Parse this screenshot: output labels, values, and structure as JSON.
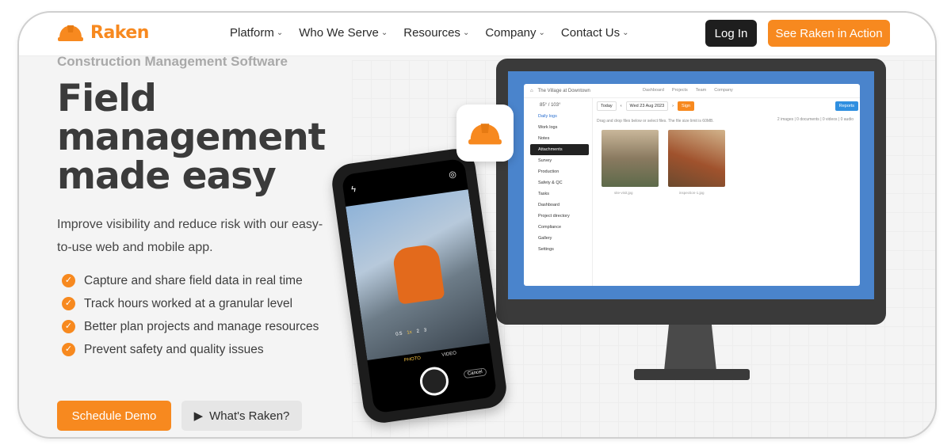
{
  "nav": {
    "brand": "Raken",
    "menu": [
      {
        "label": "Platform"
      },
      {
        "label": "Who We Serve"
      },
      {
        "label": "Resources"
      },
      {
        "label": "Company"
      },
      {
        "label": "Contact Us"
      }
    ],
    "login_label": "Log In",
    "cta_label": "See Raken in Action"
  },
  "hero": {
    "eyebrow": "Construction Management Software",
    "headline_1": "Field",
    "headline_2": "management",
    "headline_3": "made easy",
    "lead": "Improve visibility and reduce risk with our easy-to-use web and mobile app.",
    "bullets": [
      "Capture and share field data in real time",
      "Track hours worked at a granular level",
      "Better plan projects and manage resources",
      "Prevent safety and quality issues"
    ],
    "demo_label": "Schedule Demo",
    "what_label": "What's Raken?"
  },
  "monitor_app": {
    "project": "The Village at Downtown",
    "links": [
      "Dashboard",
      "Projects",
      "Team",
      "Company"
    ],
    "weather": "85° / 103°",
    "today": "Today",
    "date": "Wed 23 Aug 2023",
    "sign": "Sign",
    "reports": "Reports",
    "upload_hint": "Drag and drop files below or select files. The file size limit is 60MB.",
    "counts": "2 images | 0 documents | 0 videos | 0 audio",
    "side_items": [
      "Daily logs",
      "Work logs",
      "Notes",
      "Attachments",
      "Survey",
      "Production",
      "Safety & QC",
      "Tasks",
      "Dashboard",
      "Project directory",
      "Compliance",
      "Gallery",
      "Settings"
    ],
    "files": [
      "site-visit.jpg",
      "inspection-1.jpg"
    ]
  },
  "phone": {
    "mode_photo": "PHOTO",
    "mode_video": "VIDEO",
    "cancel": "Cancel",
    "zoom": [
      "0.5",
      "1x",
      "2",
      "3"
    ]
  },
  "colors": {
    "accent": "#f7891f",
    "dark": "#1e1e1e",
    "screen_blue": "#4a84cc"
  }
}
